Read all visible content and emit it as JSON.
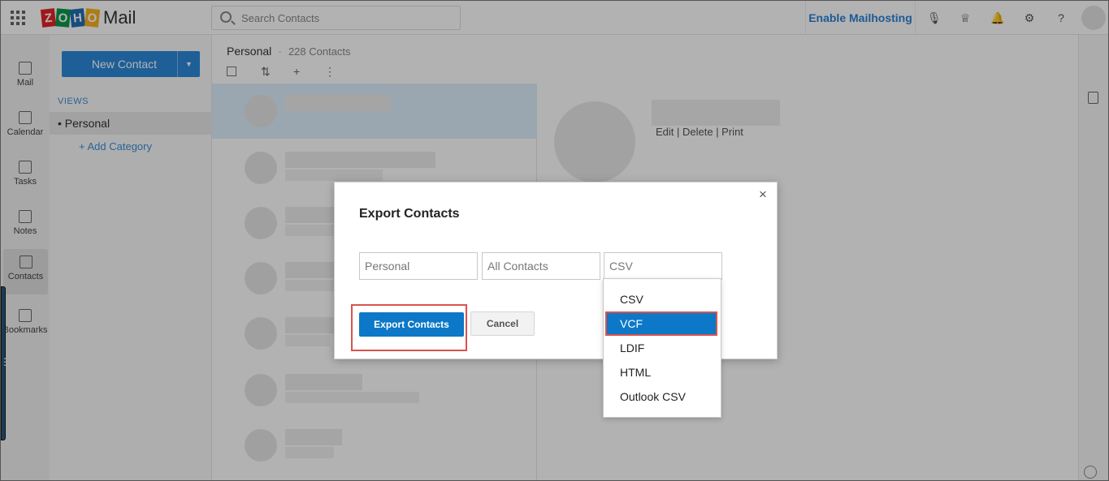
{
  "topbar": {
    "logo_letters": [
      "Z",
      "O",
      "H",
      "O"
    ],
    "logo_mail": "Mail",
    "search_placeholder": "Search Contacts",
    "enable_label": "Enable Mailhosting",
    "icons": [
      "mic-icon",
      "crown-icon",
      "bell-icon",
      "gear-icon",
      "help-icon",
      "avatar"
    ]
  },
  "rail": {
    "items": [
      {
        "label": "Mail",
        "icon": "mail-icon"
      },
      {
        "label": "Calendar",
        "icon": "calendar-icon"
      },
      {
        "label": "Tasks",
        "icon": "tasks-icon"
      },
      {
        "label": "Notes",
        "icon": "notes-icon"
      },
      {
        "label": "Contacts",
        "icon": "contacts-icon"
      },
      {
        "label": "Bookmarks",
        "icon": "bookmarks-icon"
      }
    ]
  },
  "sidebar": {
    "new_contact": "New Contact",
    "views_label": "VIEWS",
    "personal": "Personal",
    "add_category": "+ Add Category"
  },
  "list_header": {
    "folder": "Personal",
    "count": "228 Contacts"
  },
  "detail": {
    "actions": "Edit | Delete | Print"
  },
  "modal": {
    "title": "Export Contacts",
    "field_source": "Personal",
    "field_scope": "All Contacts",
    "field_format": "CSV",
    "export_button": "Export Contacts",
    "cancel_button": "Cancel",
    "format_options": [
      "CSV",
      "VCF",
      "LDIF",
      "HTML",
      "Outlook CSV"
    ],
    "highlighted_option": "VCF"
  },
  "colors": {
    "accent": "#0d78c7",
    "highlight_box": "#d9534f",
    "link": "#2c83d4"
  }
}
